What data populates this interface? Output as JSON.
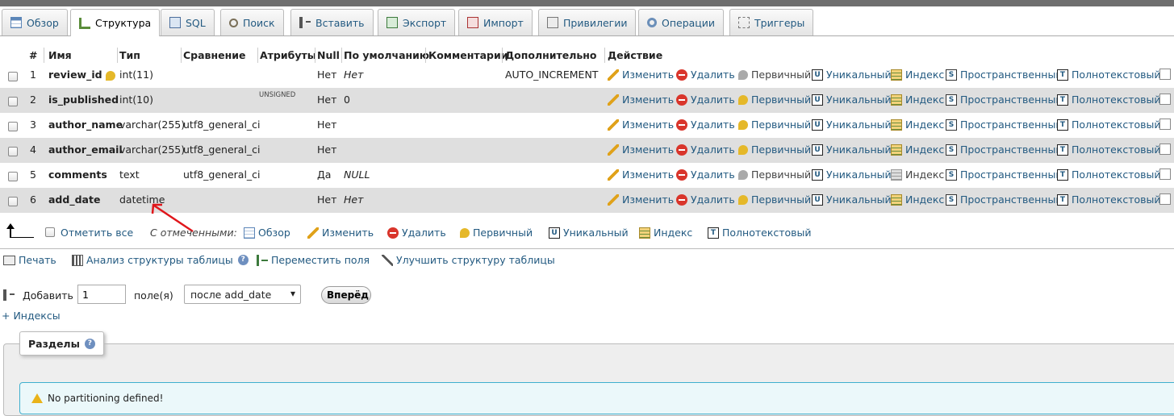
{
  "tabs": [
    {
      "label": "Обзор",
      "icon": "browse-icon"
    },
    {
      "label": "Структура",
      "icon": "structure-icon"
    },
    {
      "label": "SQL",
      "icon": "sql-icon"
    },
    {
      "label": "Поиск",
      "icon": "search-icon"
    },
    {
      "label": "Вставить",
      "icon": "insert-icon"
    },
    {
      "label": "Экспорт",
      "icon": "export-icon"
    },
    {
      "label": "Импорт",
      "icon": "import-icon"
    },
    {
      "label": "Привилегии",
      "icon": "privileges-icon"
    },
    {
      "label": "Операции",
      "icon": "operations-icon"
    },
    {
      "label": "Триггеры",
      "icon": "triggers-icon"
    }
  ],
  "table": {
    "headers": {
      "num": "#",
      "name": "Имя",
      "type": "Тип",
      "collation": "Сравнение",
      "attributes": "Атрибуты",
      "null": "Null",
      "default": "По умолчанию",
      "comments": "Комментарии",
      "extra": "Дополнительно",
      "action": "Действие"
    },
    "rows": [
      {
        "num": "1",
        "name": "review_id",
        "type": "int(11)",
        "collation": "",
        "attributes": "",
        "null": "Нет",
        "default": "Нет",
        "extra": "AUTO_INCREMENT"
      },
      {
        "num": "2",
        "name": "is_published",
        "type": "int(10)",
        "collation": "",
        "attributes": "UNSIGNED",
        "null": "Нет",
        "default": "0",
        "extra": ""
      },
      {
        "num": "3",
        "name": "author_name",
        "type": "varchar(255)",
        "collation": "utf8_general_ci",
        "attributes": "",
        "null": "Нет",
        "default": "",
        "extra": ""
      },
      {
        "num": "4",
        "name": "author_email",
        "type": "varchar(255)",
        "collation": "utf8_general_ci",
        "attributes": "",
        "null": "Нет",
        "default": "",
        "extra": ""
      },
      {
        "num": "5",
        "name": "comments",
        "type": "text",
        "collation": "utf8_general_ci",
        "attributes": "",
        "null": "Да",
        "default": "NULL",
        "extra": ""
      },
      {
        "num": "6",
        "name": "add_date",
        "type": "datetime",
        "collation": "",
        "attributes": "",
        "null": "Нет",
        "default": "Нет",
        "extra": ""
      }
    ],
    "actions": {
      "edit": "Изменить",
      "delete": "Удалить",
      "primary": "Первичный",
      "unique": "Уникальный",
      "index": "Индекс",
      "spatial": "Пространственный",
      "fulltext": "Полнотекстовый"
    }
  },
  "bulk": {
    "check_all": "Отметить все",
    "with_selected": "С отмеченными:",
    "browse": "Обзор",
    "edit": "Изменить",
    "delete": "Удалить",
    "primary": "Первичный",
    "unique": "Уникальный",
    "index": "Индекс",
    "fulltext": "Полнотекстовый"
  },
  "tools": {
    "print": "Печать",
    "analyze": "Анализ структуры таблицы",
    "move": "Переместить поля",
    "improve": "Улучшить структуру таблицы"
  },
  "add": {
    "label": "Добавить",
    "count": "1",
    "fields": "поле(я)",
    "position": "после add_date",
    "go": "Вперёд"
  },
  "indexes_link": "+ Индексы",
  "partitions": {
    "legend": "Разделы",
    "notice": "No partitioning defined!"
  },
  "colors": {
    "link": "#235a81",
    "row_even": "#dfdfdf",
    "notice_bg": "#ebf8fa",
    "notice_border": "#3fb0ce",
    "arrow": "#e0161b"
  }
}
